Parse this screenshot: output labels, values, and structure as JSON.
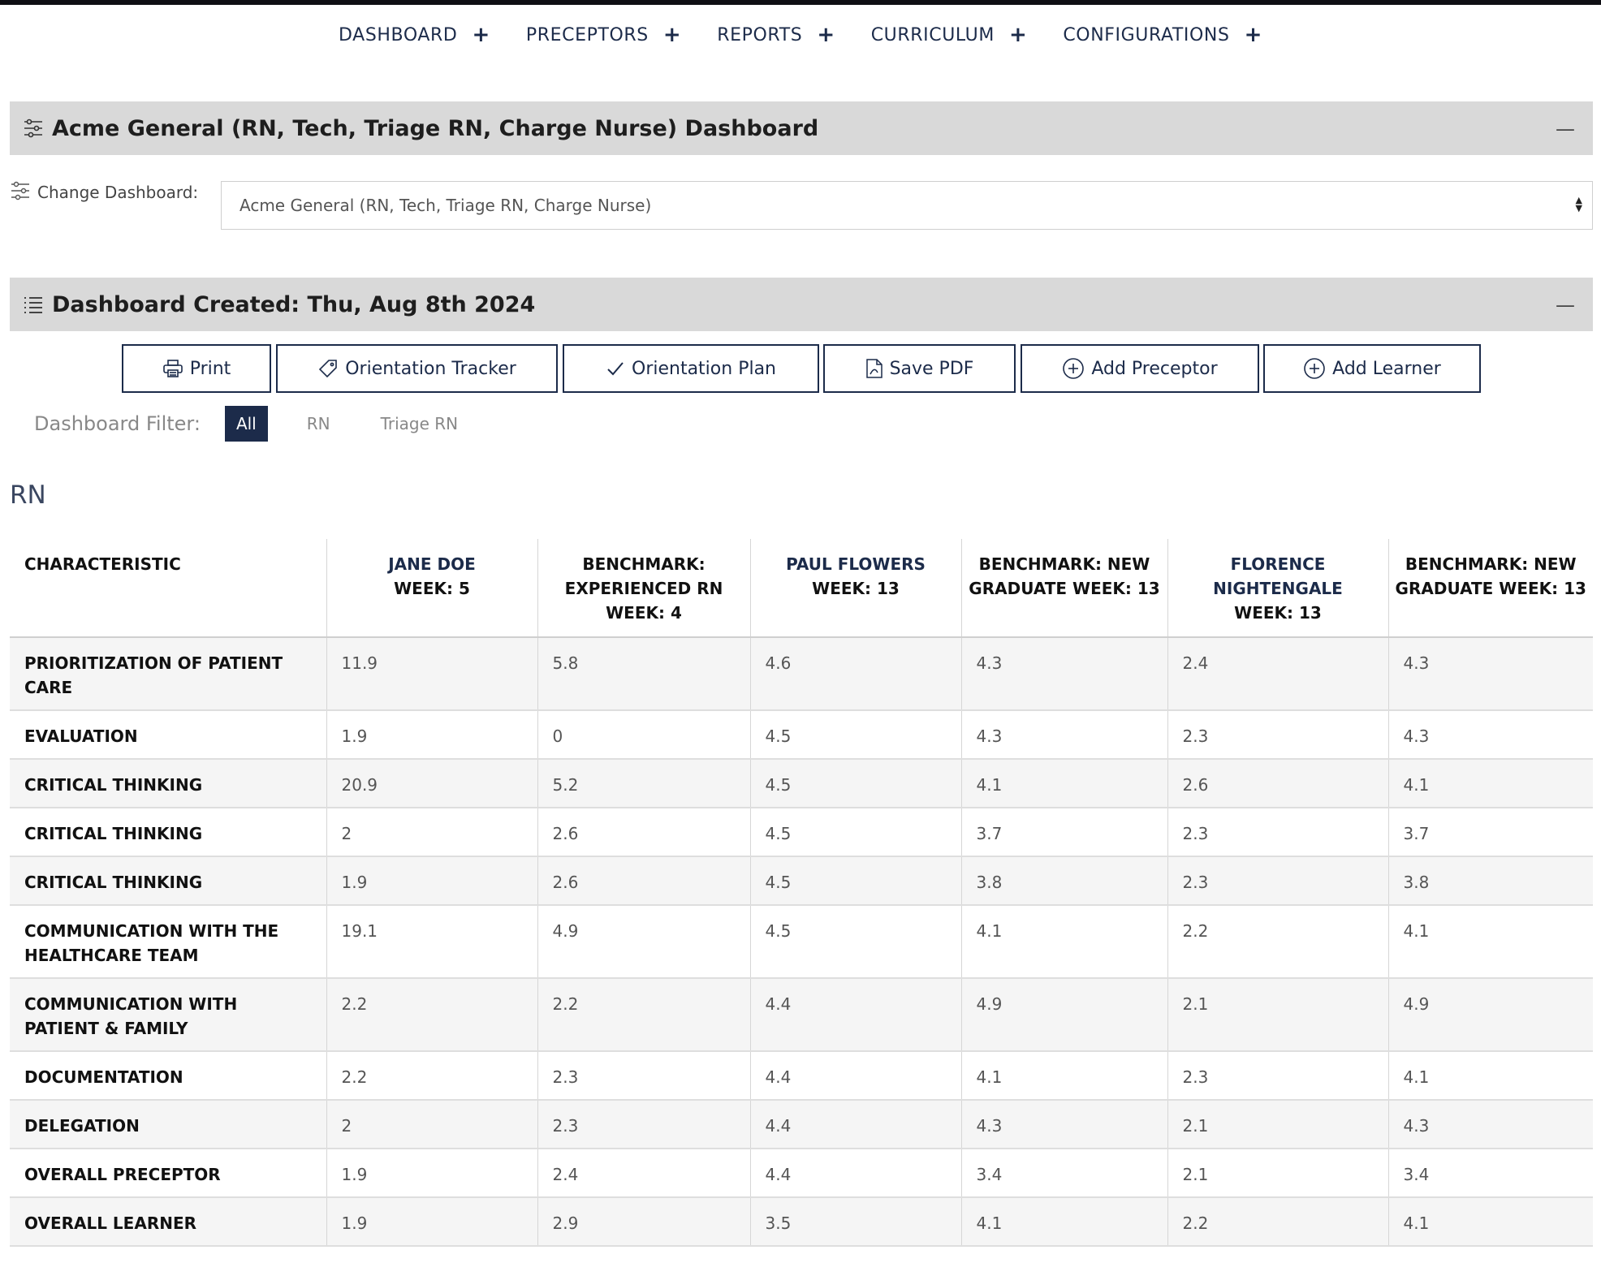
{
  "nav": {
    "items": [
      {
        "label": "DASHBOARD"
      },
      {
        "label": "PRECEPTORS"
      },
      {
        "label": "REPORTS"
      },
      {
        "label": "CURRICULUM"
      },
      {
        "label": "CONFIGURATIONS"
      }
    ],
    "plus": "+"
  },
  "dashboard_header": {
    "title": "Acme General (RN, Tech, Triage RN, Charge Nurse) Dashboard",
    "collapse": "—"
  },
  "change_dashboard": {
    "label": "Change Dashboard:",
    "selected": "Acme General (RN, Tech, Triage RN, Charge Nurse)"
  },
  "created_header": {
    "title": "Dashboard Created: Thu, Aug 8th 2024",
    "collapse": "—"
  },
  "toolbar": {
    "print": "Print",
    "orientation_tracker": "Orientation Tracker",
    "orientation_plan": "Orientation Plan",
    "save_pdf": "Save PDF",
    "add_preceptor": "Add Preceptor",
    "add_learner": "Add Learner"
  },
  "filter": {
    "label": "Dashboard Filter:",
    "options": [
      "All",
      "RN",
      "Triage RN"
    ],
    "active": "All"
  },
  "group": {
    "title": "RN"
  },
  "table": {
    "headers": [
      {
        "name": "",
        "sub": "CHARACTERISTIC"
      },
      {
        "name": "JANE DOE",
        "sub": "WEEK: 5"
      },
      {
        "name": "",
        "sub": "BENCHMARK: EXPERIENCED RN WEEK: 4"
      },
      {
        "name": "PAUL FLOWERS",
        "sub": "WEEK: 13"
      },
      {
        "name": "",
        "sub": "BENCHMARK: NEW GRADUATE WEEK: 13"
      },
      {
        "name": "FLORENCE NIGHTENGALE",
        "sub": "WEEK: 13"
      },
      {
        "name": "",
        "sub": "BENCHMARK: NEW GRADUATE WEEK: 13"
      }
    ],
    "rows": [
      [
        "PRIORITIZATION OF PATIENT CARE",
        "11.9",
        "5.8",
        "4.6",
        "4.3",
        "2.4",
        "4.3"
      ],
      [
        "EVALUATION",
        "1.9",
        "0",
        "4.5",
        "4.3",
        "2.3",
        "4.3"
      ],
      [
        "CRITICAL THINKING",
        "20.9",
        "5.2",
        "4.5",
        "4.1",
        "2.6",
        "4.1"
      ],
      [
        "CRITICAL THINKING",
        "2",
        "2.6",
        "4.5",
        "3.7",
        "2.3",
        "3.7"
      ],
      [
        "CRITICAL THINKING",
        "1.9",
        "2.6",
        "4.5",
        "3.8",
        "2.3",
        "3.8"
      ],
      [
        "COMMUNICATION WITH THE HEALTHCARE TEAM",
        "19.1",
        "4.9",
        "4.5",
        "4.1",
        "2.2",
        "4.1"
      ],
      [
        "COMMUNICATION WITH PATIENT & FAMILY",
        "2.2",
        "2.2",
        "4.4",
        "4.9",
        "2.1",
        "4.9"
      ],
      [
        "DOCUMENTATION",
        "2.2",
        "2.3",
        "4.4",
        "4.1",
        "2.3",
        "4.1"
      ],
      [
        "DELEGATION",
        "2",
        "2.3",
        "4.4",
        "4.3",
        "2.1",
        "4.3"
      ],
      [
        "OVERALL PRECEPTOR",
        "1.9",
        "2.4",
        "4.4",
        "3.4",
        "2.1",
        "3.4"
      ],
      [
        "OVERALL LEARNER",
        "1.9",
        "2.9",
        "3.5",
        "4.1",
        "2.2",
        "4.1"
      ]
    ]
  },
  "colors": {
    "navy": "#1c2b4a",
    "section_bg": "#d9d9d9",
    "stripe": "#f5f5f5"
  }
}
